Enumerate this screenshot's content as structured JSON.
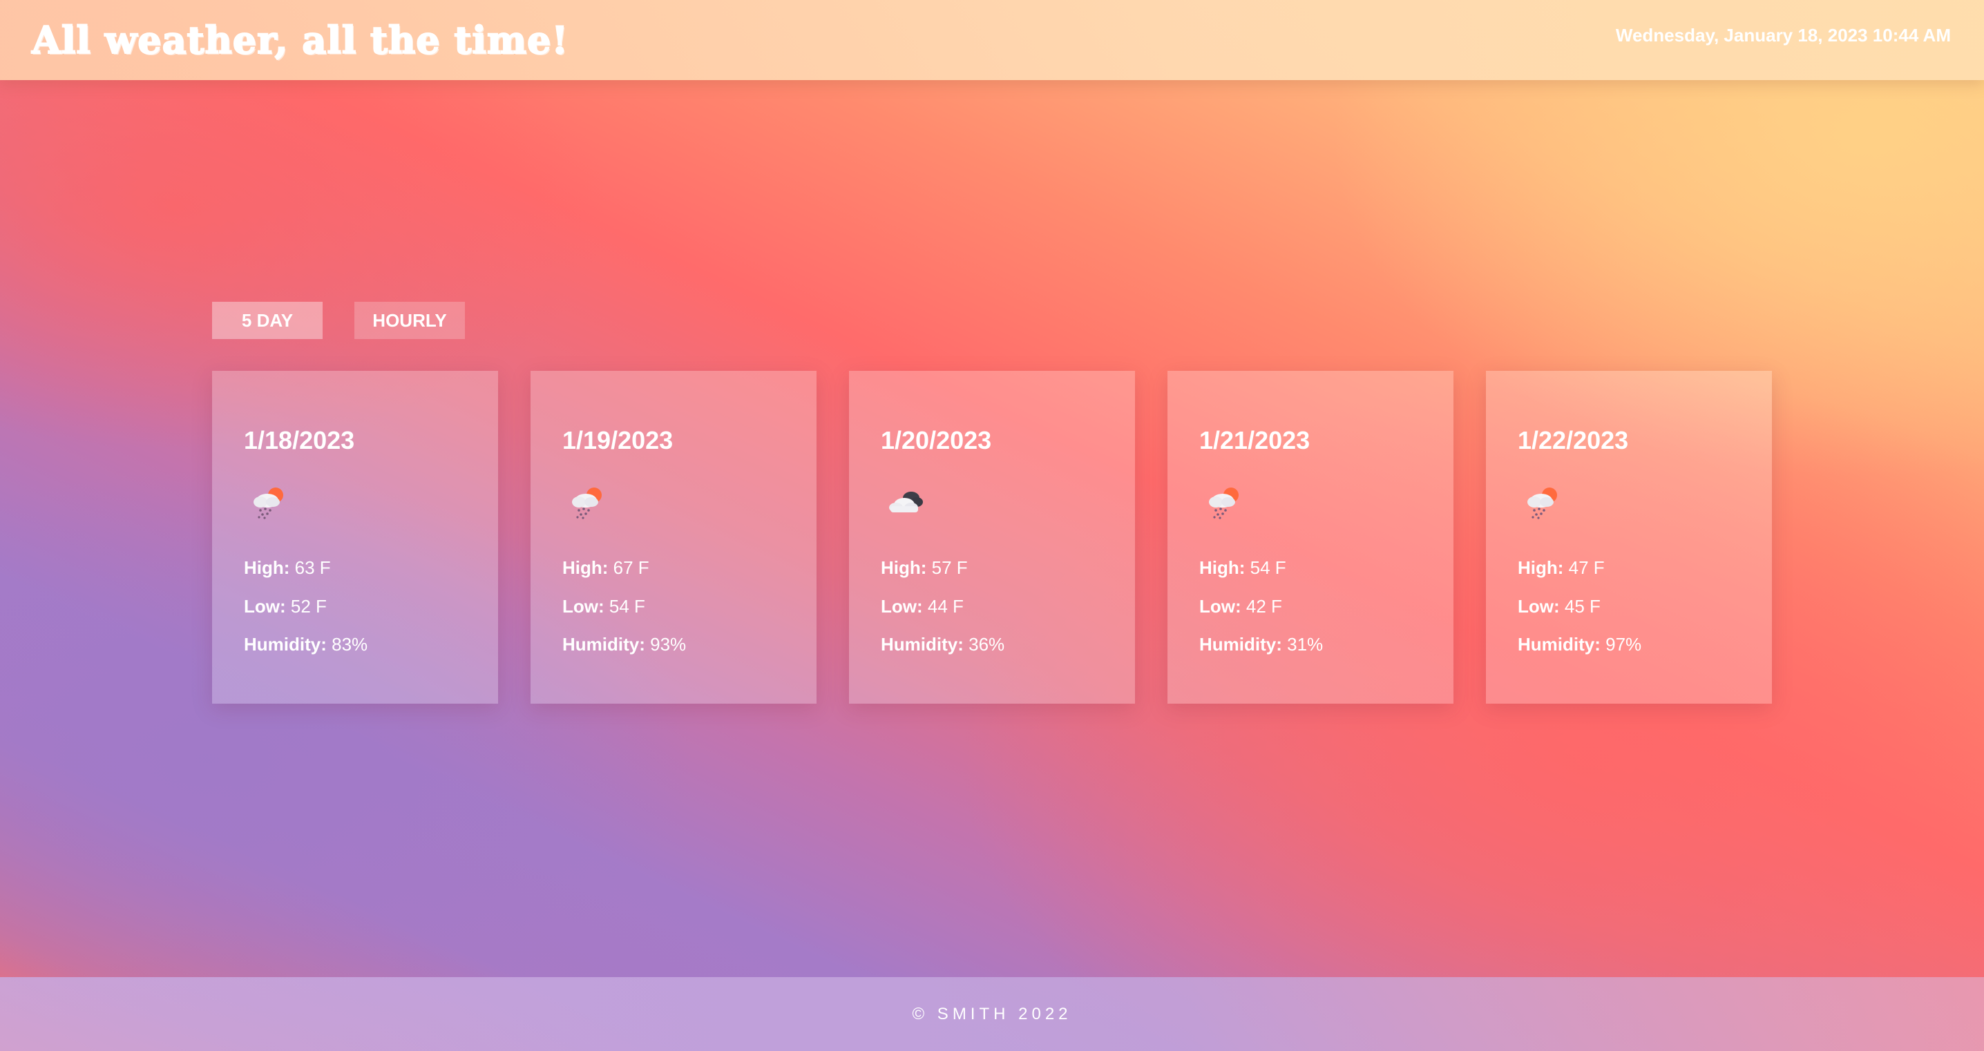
{
  "header": {
    "title": "All weather, all the time!",
    "datetime": "Wednesday, January 18, 2023 10:44 AM"
  },
  "tabs": [
    {
      "label": "5 DAY",
      "active": true
    },
    {
      "label": "HOURLY",
      "active": false
    }
  ],
  "labels": {
    "high": "High:",
    "low": "Low:",
    "humidity": "Humidity:"
  },
  "forecast": [
    {
      "date": "1/18/2023",
      "icon": "rain-cloud-sun-icon",
      "high": "63 F",
      "low": "52 F",
      "humidity": "83%"
    },
    {
      "date": "1/19/2023",
      "icon": "rain-cloud-sun-icon",
      "high": "67 F",
      "low": "54 F",
      "humidity": "93%"
    },
    {
      "date": "1/20/2023",
      "icon": "broken-clouds-icon",
      "high": "57 F",
      "low": "44 F",
      "humidity": "36%"
    },
    {
      "date": "1/21/2023",
      "icon": "rain-cloud-sun-icon",
      "high": "54 F",
      "low": "42 F",
      "humidity": "31%"
    },
    {
      "date": "1/22/2023",
      "icon": "rain-cloud-sun-icon",
      "high": "47 F",
      "low": "45 F",
      "humidity": "97%"
    }
  ],
  "footer": {
    "text": "© SMITH 2022"
  }
}
